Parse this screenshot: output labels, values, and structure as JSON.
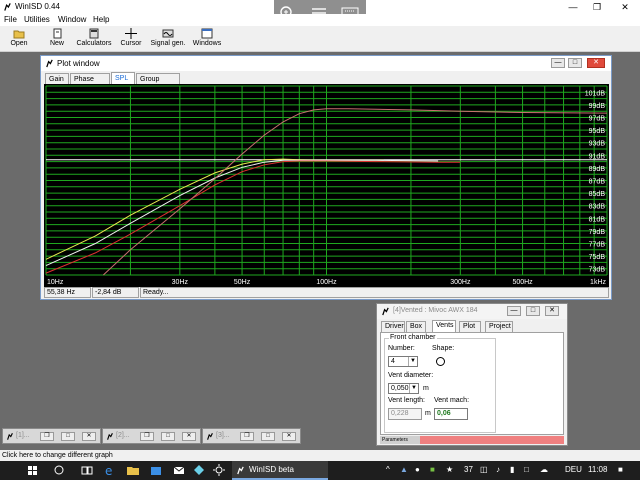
{
  "app": {
    "title": "WinISD 0.44"
  },
  "menu": [
    "File",
    "Utilities",
    "Window",
    "Help"
  ],
  "toolbar": [
    "Open",
    "New",
    "Calculators",
    "Cursor",
    "Signal gen.",
    "Windows"
  ],
  "plot_window": {
    "title": "Plot window",
    "tabs": [
      "Gain",
      "Phase plot",
      "SPL",
      "Group delay"
    ],
    "active_tab": "SPL",
    "status": {
      "freq": "55,38 Hz",
      "gain": "-2,84 dB",
      "state": "Ready..."
    }
  },
  "chart_data": {
    "type": "line",
    "x_scale": "log",
    "xlim": [
      10,
      1000
    ],
    "ylim": [
      72,
      102
    ],
    "x_tick_labels": [
      "10Hz",
      "30Hz",
      "50Hz",
      "100Hz",
      "300Hz",
      "500Hz",
      "1kHz"
    ],
    "x_tick_values": [
      10,
      30,
      50,
      100,
      300,
      500,
      1000
    ],
    "y_tick_labels": [
      "101dB",
      "99dB",
      "97dB",
      "95dB",
      "93dB",
      "91dB",
      "89dB",
      "87dB",
      "85dB",
      "83dB",
      "81dB",
      "79dB",
      "77dB",
      "75dB",
      "73dB"
    ],
    "y_tick_values": [
      101,
      99,
      97,
      95,
      93,
      91,
      89,
      87,
      85,
      83,
      81,
      79,
      77,
      75,
      73
    ],
    "grid": true,
    "colors": {
      "background": "#000000",
      "grid": "#1fa81f",
      "labels": "#ffffff"
    },
    "cursor_db": 90.3,
    "series": [
      {
        "color": "#e8e850",
        "x": [
          10,
          15,
          20,
          30,
          40,
          50,
          60,
          70,
          80,
          100,
          150,
          160
        ],
        "y": [
          74.5,
          78.2,
          81.5,
          85.6,
          88.2,
          89.6,
          90.3,
          90.4,
          90.3,
          90.2,
          90.2,
          90.2
        ]
      },
      {
        "color": "#f0f0f0",
        "x": [
          10,
          15,
          20,
          30,
          40,
          50,
          60,
          70,
          80,
          100,
          150,
          250
        ],
        "y": [
          73.5,
          77.0,
          80.2,
          84.6,
          87.4,
          89.1,
          89.9,
          90.2,
          90.2,
          90.2,
          90.2,
          90.1
        ]
      },
      {
        "color": "#e03030",
        "x": [
          10,
          15,
          20,
          30,
          40,
          50,
          60,
          70,
          80,
          100,
          150,
          250,
          300
        ],
        "y": [
          72.3,
          75.5,
          78.5,
          83.0,
          86.3,
          88.4,
          89.5,
          90.0,
          90.1,
          90.1,
          90.0,
          89.9,
          89.9
        ]
      },
      {
        "color": "#c97070",
        "x": [
          16,
          20,
          30,
          40,
          50,
          60,
          70,
          80,
          90,
          100,
          120,
          150,
          200,
          300,
          500,
          1000
        ],
        "y": [
          72.0,
          76.0,
          82.5,
          87.3,
          91.2,
          94.2,
          96.3,
          97.6,
          98.2,
          98.4,
          98.4,
          98.3,
          98.2,
          98.0,
          97.8,
          97.7
        ]
      }
    ]
  },
  "box_window": {
    "title": "[4]Vented : Mivoc AWX 184",
    "tabs": [
      "Driver",
      "Box",
      "Vents",
      "Plot",
      "Project"
    ],
    "active_tab": "Vents",
    "group_label": "Front chamber",
    "number_label": "Number:",
    "number_value": "4",
    "shape_label": "Shape:",
    "diameter_label": "Vent diameter:",
    "diameter_value": "0,050",
    "diameter_unit": "m",
    "length_label": "Vent length:",
    "length_value": "0,228",
    "length_unit": "m",
    "mach_label": "Vent mach:",
    "mach_value": "0,06",
    "footer_label": "Parameters"
  },
  "minimized": [
    "[1]...",
    "[2]...",
    "[3]..."
  ],
  "status_bar": "Click here to change different graph",
  "taskbar": {
    "app_button": "WinISD beta",
    "temp": "37",
    "lang": "DEU",
    "time": "11:08"
  }
}
